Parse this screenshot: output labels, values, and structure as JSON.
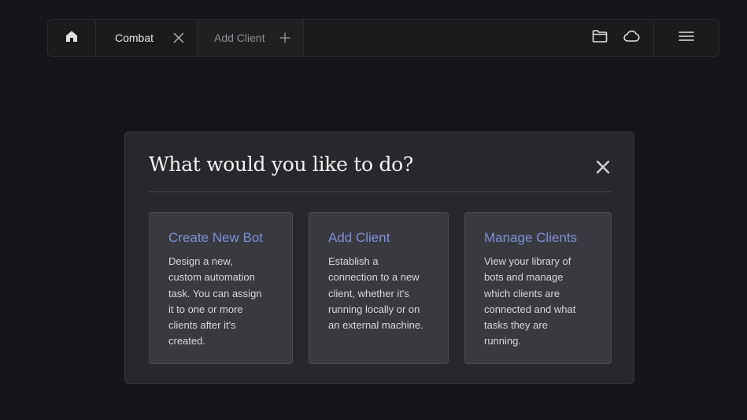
{
  "tabs": [
    {
      "label": "Combat",
      "action_icon": "close-icon"
    },
    {
      "label": "Add Client",
      "action_icon": "plus-icon"
    }
  ],
  "toolbar": {
    "home_icon": "home-icon",
    "folder_icon": "folder-icon",
    "cloud_icon": "cloud-icon",
    "menu_icon": "hamburger-menu-icon"
  },
  "dialog": {
    "title": "What would you like to do?",
    "close_icon": "close-icon",
    "cards": [
      {
        "title": "Create New Bot",
        "lines": [
          "Design a new,",
          "custom automation",
          "task. You can assign",
          "it to one or more",
          "clients after it's",
          "created."
        ]
      },
      {
        "title": "Add Client",
        "lines": [
          "Establish a",
          "connection to a new",
          "client, whether it's",
          "running locally or on",
          "an external machine."
        ]
      },
      {
        "title": "Manage Clients",
        "lines": [
          "View your library of",
          "bots and manage",
          "which clients are",
          "connected and what",
          "tasks they are",
          "running."
        ]
      }
    ]
  },
  "colors": {
    "background": "#16161a",
    "dialog": "#27282c",
    "card": "#383a40",
    "accent": "#7f8fd6"
  }
}
